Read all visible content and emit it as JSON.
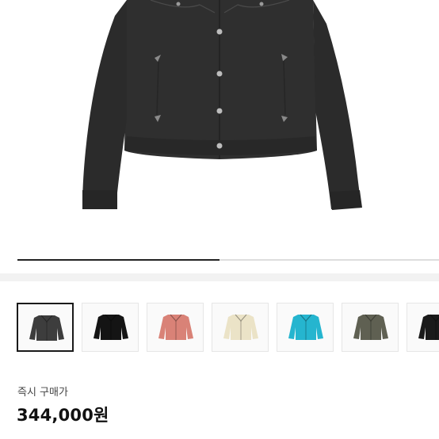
{
  "gallery": {
    "progress": 0.48
  },
  "thumbnails": [
    {
      "name": "thumb-charcoal",
      "color": "#3d3d3d",
      "selected": true
    },
    {
      "name": "thumb-black",
      "color": "#141414",
      "selected": false
    },
    {
      "name": "thumb-pink",
      "color": "#d98277",
      "selected": false
    },
    {
      "name": "thumb-cream",
      "color": "#ebe3c7",
      "selected": false
    },
    {
      "name": "thumb-turquoise",
      "color": "#25b5cf",
      "selected": false
    },
    {
      "name": "thumb-olive",
      "color": "#5f6052",
      "selected": false
    },
    {
      "name": "thumb-black-2",
      "color": "#1a1a1a",
      "selected": false
    }
  ],
  "price_section": {
    "label": "즉시 구매가",
    "price": "344,000원"
  },
  "colors": {
    "jacket_main": "#2f2f2f",
    "progress_fill": "#222222",
    "progress_track": "#dddddd"
  }
}
